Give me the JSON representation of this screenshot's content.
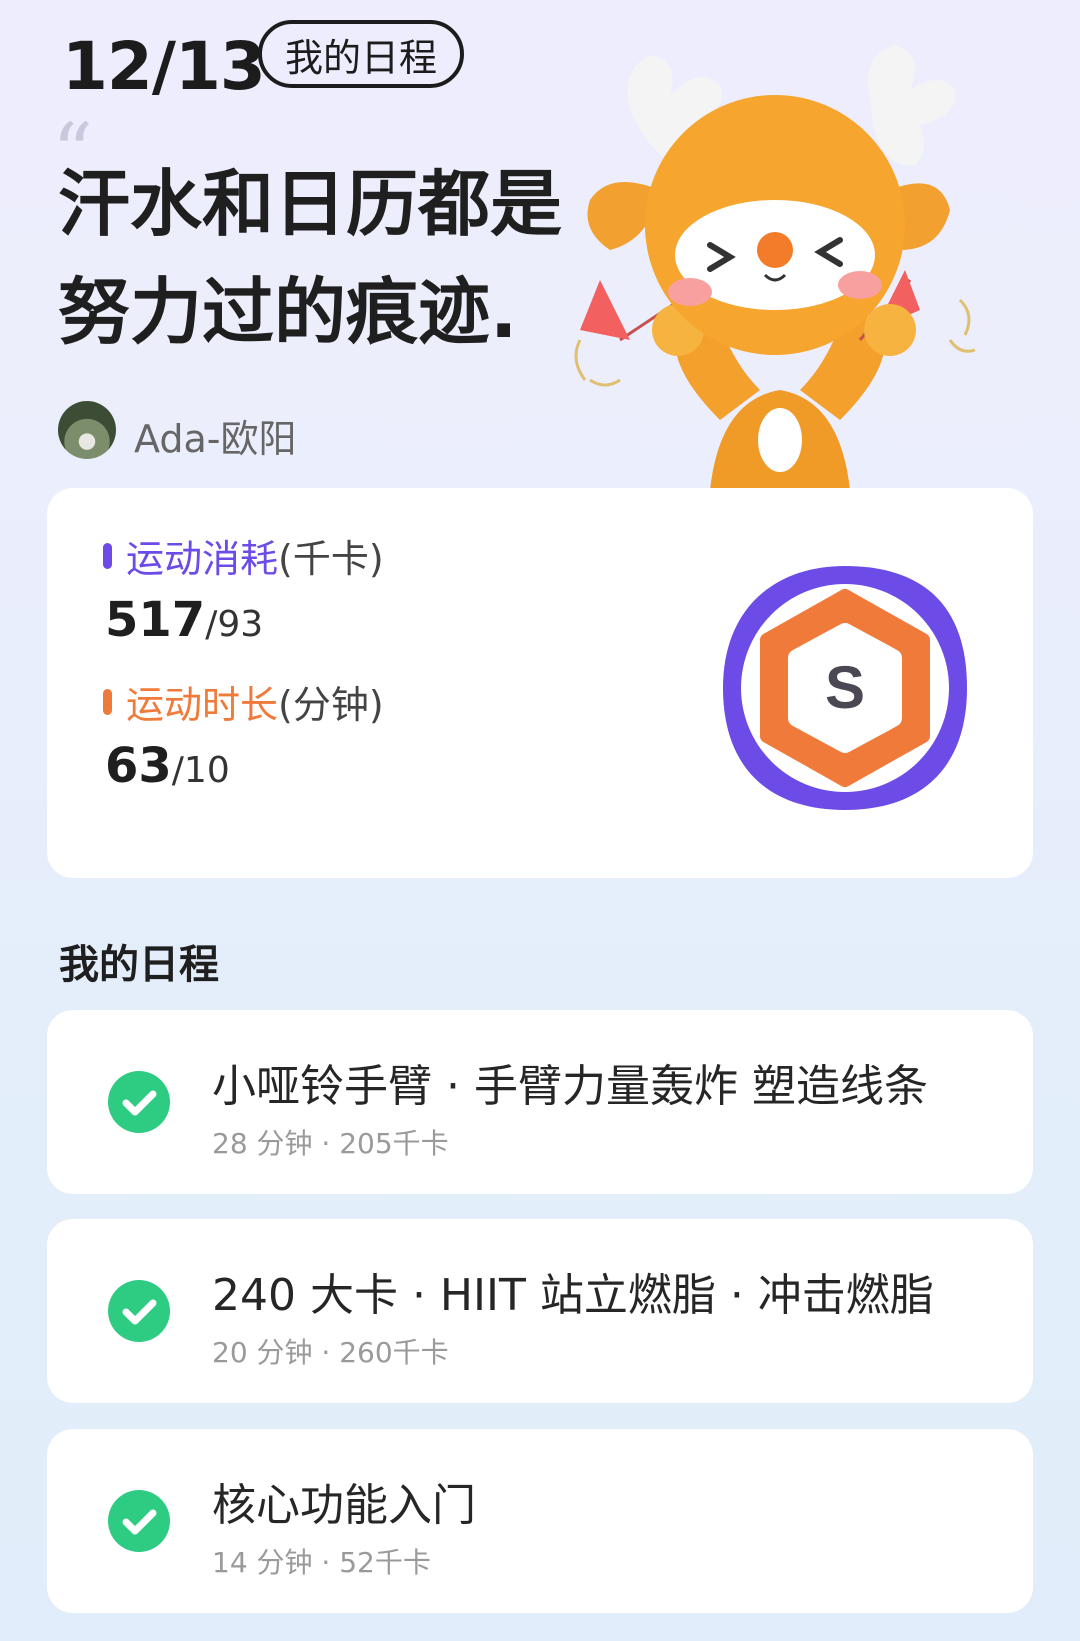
{
  "header": {
    "date": "12/13",
    "tag_label": "我的日程",
    "quote_mark": "“",
    "slogan_line1": "汗水和日历都是",
    "slogan_line2": "努力过的痕迹.",
    "username": "Ada-欧阳"
  },
  "stats": {
    "calories": {
      "label_colored": "运动消耗",
      "label_unit": "(千卡)",
      "value": "517",
      "target": "/93",
      "color": "#6c4be6"
    },
    "duration": {
      "label_colored": "运动时长",
      "label_unit": "(分钟)",
      "value": "63",
      "target": "/10",
      "color": "#f07a3a"
    },
    "badge_letter": "S"
  },
  "schedule": {
    "title": "我的日程",
    "items": [
      {
        "title": "小哑铃手臂 · 手臂力量轰炸 塑造线条",
        "meta": "28 分钟 · 205千卡"
      },
      {
        "title": "240 大卡 · HIIT 站立燃脂 · 冲击燃脂",
        "meta": "20 分钟 · 260千卡"
      },
      {
        "title": "核心功能入门",
        "meta": "14 分钟 · 52千卡"
      }
    ]
  },
  "colors": {
    "accent_purple": "#6c4be6",
    "accent_orange": "#f07a3a",
    "check_green": "#2ecb82"
  }
}
